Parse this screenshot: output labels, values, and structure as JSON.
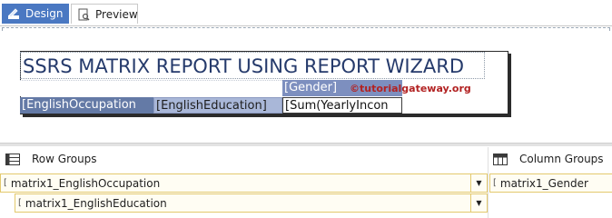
{
  "tabs": [
    {
      "label": "Design",
      "active": true,
      "icon": "ruler-pencil-icon"
    },
    {
      "label": "Preview",
      "active": false,
      "icon": "preview-icon"
    }
  ],
  "report": {
    "title": "SSRS MATRIX REPORT USING REPORT WIZARD",
    "column_group_field": "[Gender]",
    "row_group_field_1": "[EnglishOccupation",
    "row_group_field_2": "[EnglishEducation]",
    "data_field": "[Sum(YearlyIncon"
  },
  "watermark": "©tutorialgateway.org",
  "groups_panel": {
    "row_groups_label": "Row Groups",
    "column_groups_label": "Column Groups",
    "row_groups": [
      "matrix1_EnglishOccupation",
      "matrix1_EnglishEducation"
    ],
    "column_groups": [
      "matrix1_Gender"
    ]
  },
  "colors": {
    "active_tab": "#4a78c2",
    "title_text": "#253a6b",
    "column_header_bg": "#7d8fbf",
    "row_header_bg": "#647aa6",
    "row_header2_bg": "#a9b7d8",
    "group_border": "#e3c96e"
  }
}
